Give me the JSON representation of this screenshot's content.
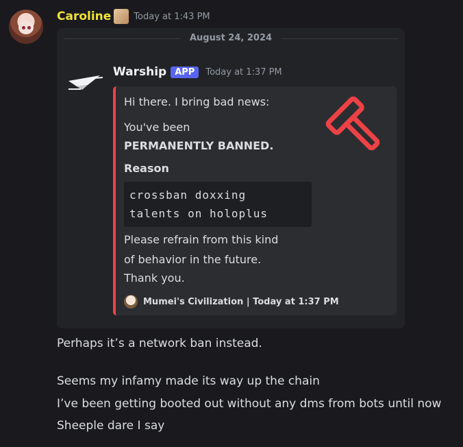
{
  "message": {
    "author": "Caroline",
    "timestamp": "Today at 1:43 PM"
  },
  "embed_container": {
    "date_divider": "August 24, 2024",
    "bot": {
      "name": "Warship",
      "badge": "APP",
      "timestamp": "Today at 1:37 PM"
    },
    "embed": {
      "accent_color": "#ed4245",
      "line1": "Hi there. I bring bad news:",
      "line2": "You've been",
      "line3": "PERMANENTLY BANNED.",
      "reason_label": "Reason",
      "reason_line1": "crossban doxxing",
      "reason_line2": "talents on holoplus",
      "note1": "Please refrain from this kind",
      "note2": "of behavior in the future.",
      "note3": "Thank you.",
      "footer": "Mumei's Civilization | Today at 1:37 PM",
      "thumbnail_icon": "gavel-icon"
    }
  },
  "followups": [
    "Perhaps it’s a network ban instead.",
    "Seems my infamy made its way up the chain",
    "I’ve been getting booted out without any dms from bots until now",
    "Sheeple dare I say"
  ],
  "colors": {
    "username": "#f0e23a",
    "app_badge": "#5865f2",
    "background": "#1a1a1e"
  }
}
